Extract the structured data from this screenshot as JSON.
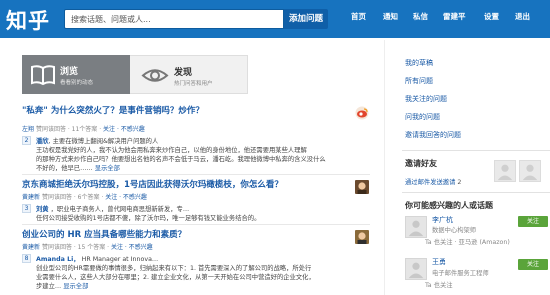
{
  "header": {
    "logo": "知乎",
    "search_placeholder": "搜索话题、问题或人...",
    "ask_button": "添加问题",
    "nav": [
      "首页",
      "通知",
      "私信",
      "雷建平",
      "设置",
      "退出"
    ]
  },
  "tiles": [
    {
      "title": "浏览",
      "subtitle": "看看别的动态"
    },
    {
      "title": "发现",
      "subtitle": "热门问答和用户"
    }
  ],
  "feed": [
    {
      "title": "\"私奔\"  为什么突然火了？是事件营销吗？炒作？",
      "meta_author": "左翔",
      "meta_text": "赞同该回答 · 11个答案 · ",
      "meta_actions": "关注 · 不感兴趣",
      "votes": "2",
      "body_name": "潘欣",
      "body_lines": [
        "主要在微博上翻阅&解决用户问题的人",
        "王功权是我党好的人，我不认为他会用私奔来炒作自己，以他的身份地位，他还需要用某些人理解",
        "的那种方式来炒作自己吗？他要想出名他的名声不会低于马云，潘石屹。我理他微博中私奔的含义没什么",
        "不好的，他早已……"
      ],
      "body_more": "显示全部"
    },
    {
      "title": "京东商城拒绝沃尔玛控股，1号店因此获得沃尔玛橄榄枝，你怎么看？",
      "meta_author": "黄建新",
      "meta_text": "赞同该回答 · 6个答案 · ",
      "meta_actions": "关注 · 不感兴趣",
      "votes": "3",
      "body_name": "刘黄",
      "body_lines": [
        "，职业电子商务人，曾代网电商思想新新发，专…",
        "任何公司接受收购的1号店都不傻，除了沃尔玛，唯一足够有钱又能业务结合的。"
      ],
      "body_more": ""
    },
    {
      "title": "创业公司的  HR 应当具备哪些能力和素质？",
      "meta_author": "黄建新",
      "meta_text": "赞同该回答 · 15 个答案 · ",
      "meta_actions": "关注 · 不感兴趣",
      "votes": "8",
      "body_name": "Amanda Li，",
      "body_lines": [
        "HR Manager at Innova…",
        "创业型公司的HR需要做的事情很多，归纳起来有以下：1. 首先需要深入的了解公司的战略，所处行",
        "业需要什么人，这些人大部分在哪里；2. 建立企业文化，从第一天开始在公司中营造好的企业文化，",
        "步建立…"
      ],
      "body_more": "显示全部"
    }
  ],
  "sidebar": {
    "links": [
      "我的草稿",
      "所有问题",
      "我关注的问题",
      "问我的问题",
      "邀请我回答的问题"
    ],
    "invite_heading": "邀请好友",
    "invite_text": "通过邮件发送邀请",
    "invite_counts": "2",
    "suggest_heading": "你可能感兴趣的人或话题",
    "suggestions": [
      {
        "name": "李广杭",
        "desc": "数据中心构架师",
        "desc2": "Ta 也关注 · 亚马逊 (Amazon)",
        "button": "关注"
      },
      {
        "name": "王勇",
        "desc": "电子邮件服务工程师",
        "desc2": "Ta 也关注",
        "button": "关注"
      }
    ]
  },
  "colors": {
    "topbar": "#1773bf",
    "link": "#1a5aa6",
    "follow": "#5aa43a"
  }
}
